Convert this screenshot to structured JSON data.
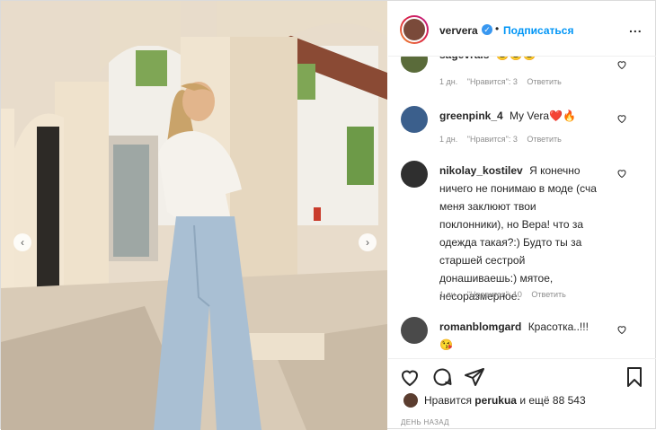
{
  "colors": {
    "link": "#0095f6",
    "verified": "#3897f0",
    "meta": "#8e8e8e"
  },
  "header": {
    "username": "ververa",
    "verified_icon": "verified-badge-icon",
    "separator": "•",
    "follow_label": "Подписаться",
    "more_label": "..."
  },
  "comments": [
    {
      "username": "sagevrals",
      "text": "😊😊😊",
      "time": "1 дн.",
      "likes": "\"Нравится\": 3",
      "reply": "Ответить"
    },
    {
      "username": "greenpink_4",
      "text": "My Vera❤️🔥",
      "time": "1 дн.",
      "likes": "\"Нравится\": 3",
      "reply": "Ответить"
    },
    {
      "username": "nikolay_kostilev",
      "text": "Я конечно ничего не понимаю в моде (сча меня заклюют твои поклонники), но Вера! что за одежда такая?:) Будто ты за старшей сестрой донашиваешь:) мятое, несоразмерное.",
      "time": "1 дн.",
      "likes": "\"Нравится\": 10",
      "reply": "Ответить"
    },
    {
      "username": "romanblomgard",
      "text": "Красотка..!!! 😘",
      "time": "",
      "likes": "",
      "reply": ""
    }
  ],
  "actions": {
    "like_icon": "heart-icon",
    "comment_icon": "comment-icon",
    "share_icon": "share-icon",
    "save_icon": "bookmark-icon"
  },
  "likes": {
    "prefix": "Нравится",
    "user": "perukua",
    "suffix": "и ещё 88 543"
  },
  "timestamp": "ДЕНЬ НАЗАД",
  "nav": {
    "prev": "‹",
    "next": "›"
  }
}
